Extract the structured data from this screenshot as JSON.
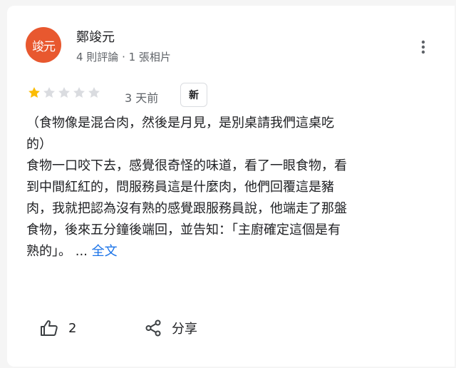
{
  "reviewer": {
    "avatar_text": "竣元",
    "name": "鄭竣元",
    "meta": "4 則評論 · 1 張相片"
  },
  "rating": {
    "value": 1,
    "max": 5,
    "filled_color": "#fbbc04",
    "empty_color": "#dadce0"
  },
  "time_ago": "3 天前",
  "new_badge": "新",
  "review_lines": [
    "（食物像是混合肉，然後是月見，是別桌請我們這桌吃",
    "的）",
    "食物一口咬下去，感覺很奇怪的味道，看了一眼食物，看",
    "到中間紅紅的，問服務員這是什麼肉，他們回覆這是豬",
    "肉，我就把認為沒有熟的感覺跟服務員說，他端走了那盤",
    "食物，後來五分鐘後端回，並告知：「主廚確定這個是有",
    "熟的」。 ..."
  ],
  "more_link": "全文",
  "actions": {
    "like_count": "2",
    "share_label": "分享"
  },
  "icons": {
    "more": "more-vert-icon",
    "like": "thumb-up-icon",
    "share": "share-icon"
  },
  "colors": {
    "avatar_bg": "#e8582f",
    "link": "#1a73e8"
  }
}
